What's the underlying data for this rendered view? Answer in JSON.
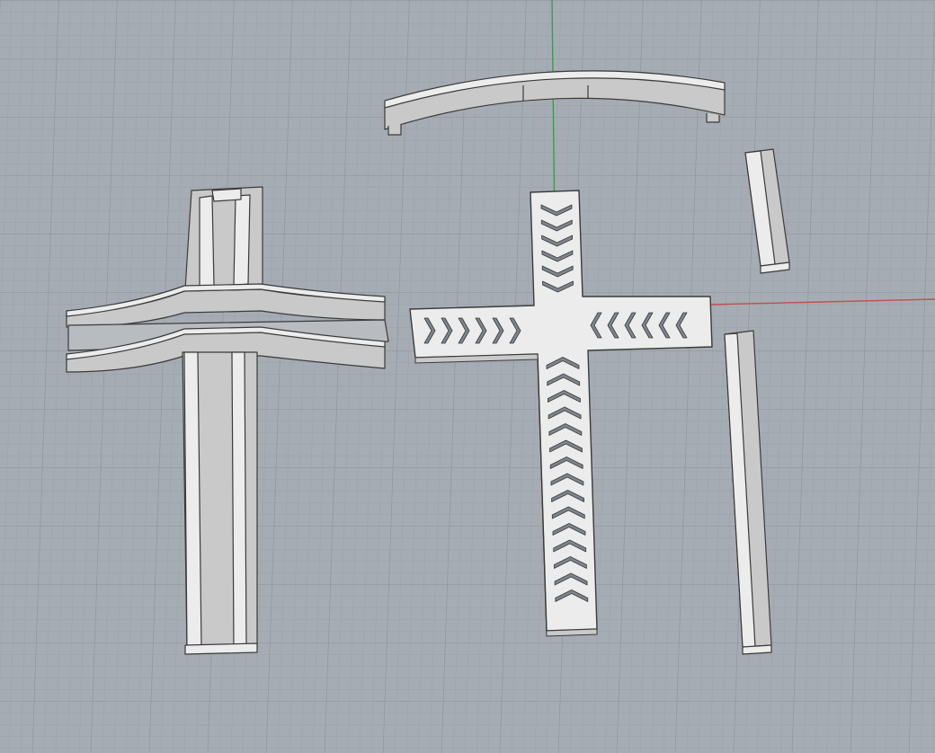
{
  "viewport": {
    "background": "#a6acb3",
    "grid_minor_color": "#9ba1a8",
    "grid_major_color": "#8f959c",
    "axis_x_color": "#c0504d",
    "axis_y_color": "#3f9a4f",
    "part_face_color": "#ececec",
    "part_side_color": "#c9c9c9",
    "part_edge_color": "#3a3a3a",
    "cutout_color": "#7f858c"
  },
  "parts": [
    {
      "name": "curved-top-rail"
    },
    {
      "name": "short-post"
    },
    {
      "name": "long-post"
    },
    {
      "name": "cross-frame"
    },
    {
      "name": "perforated-cross-plate"
    }
  ]
}
